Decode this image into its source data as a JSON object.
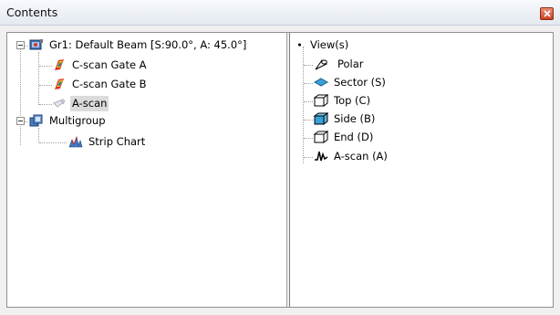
{
  "window": {
    "title": "Contents"
  },
  "left_tree": {
    "root": {
      "label": "Gr1: Default Beam [S:90.0°, A: 45.0°]",
      "icon": "beam-group-icon"
    },
    "children": [
      {
        "label": "C-scan Gate A",
        "icon": "cscan-colormap-icon"
      },
      {
        "label": "C-scan Gate B",
        "icon": "cscan-colormap-icon"
      },
      {
        "label": "A-scan",
        "icon": "ascan-ghost-icon",
        "selected": true
      }
    ],
    "multigroup": {
      "label": "Multigroup",
      "icon": "multigroup-icon"
    },
    "multigroup_children": [
      {
        "label": "Strip Chart",
        "icon": "strip-chart-icon"
      }
    ]
  },
  "right_tree": {
    "root": {
      "label": "View(s)",
      "icon": "bullet-icon"
    },
    "items": [
      {
        "label": "Polar",
        "icon": "polar-cone-icon"
      },
      {
        "label": "Sector (S)",
        "icon": "sector-diamond-icon"
      },
      {
        "label": "Top (C)",
        "icon": "top-cube-icon"
      },
      {
        "label": "Side (B)",
        "icon": "side-cube-icon"
      },
      {
        "label": "End (D)",
        "icon": "end-cube-icon"
      },
      {
        "label": "A-scan (A)",
        "icon": "ascan-wave-icon"
      }
    ]
  }
}
